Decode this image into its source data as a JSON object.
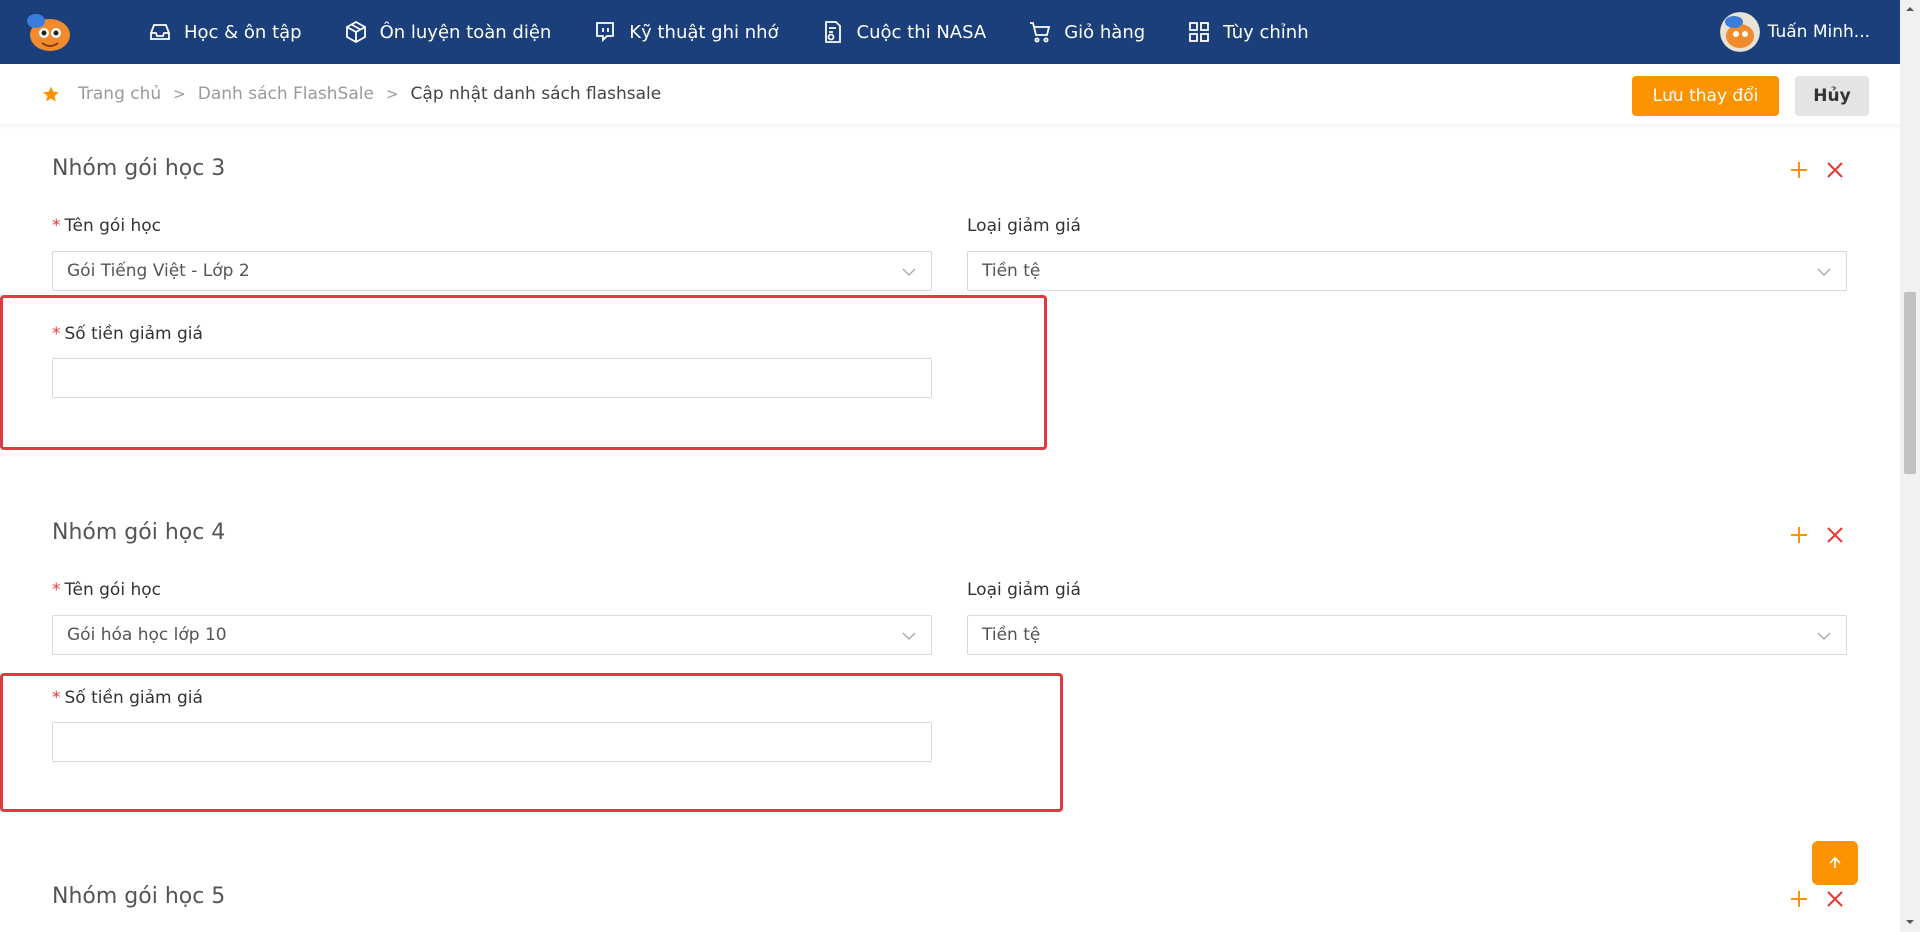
{
  "nav": {
    "items": [
      {
        "label": "Học & ôn tập",
        "icon": "inbox-icon"
      },
      {
        "label": "Ôn luyện toàn diện",
        "icon": "box-icon"
      },
      {
        "label": "Kỹ thuật ghi nhớ",
        "icon": "chat-icon"
      },
      {
        "label": "Cuộc thi NASA",
        "icon": "contest-icon"
      },
      {
        "label": "Giỏ hàng",
        "icon": "cart-icon"
      },
      {
        "label": "Tùy chỉnh",
        "icon": "grid-icon"
      }
    ],
    "user_name": "Tuấn Minh..."
  },
  "breadcrumb": {
    "home": "Trang chủ",
    "list": "Danh sách FlashSale",
    "current": "Cập nhật danh sách flashsale",
    "separator": ">"
  },
  "actions": {
    "save_label": "Lưu thay đổi",
    "cancel_label": "Hủy"
  },
  "groups": [
    {
      "title": "Nhóm gói học 3",
      "package_label": "Tên gói học",
      "package_value": "Gói Tiếng Việt - Lớp 2",
      "discount_type_label": "Loại giảm giá",
      "discount_type_value": "Tiền tệ",
      "amount_label": "Số tiền giảm giá",
      "amount_value": ""
    },
    {
      "title": "Nhóm gói học 4",
      "package_label": "Tên gói học",
      "package_value": "Gói hóa học lớp 10",
      "discount_type_label": "Loại giảm giá",
      "discount_type_value": "Tiền tệ",
      "amount_label": "Số tiền giảm giá",
      "amount_value": ""
    },
    {
      "title": "Nhóm gói học 5"
    }
  ],
  "required_mark": "*",
  "colors": {
    "navbar": "#1b3f7b",
    "accent": "#fb9400",
    "danger": "#e53935",
    "highlight": "#e0393f"
  }
}
